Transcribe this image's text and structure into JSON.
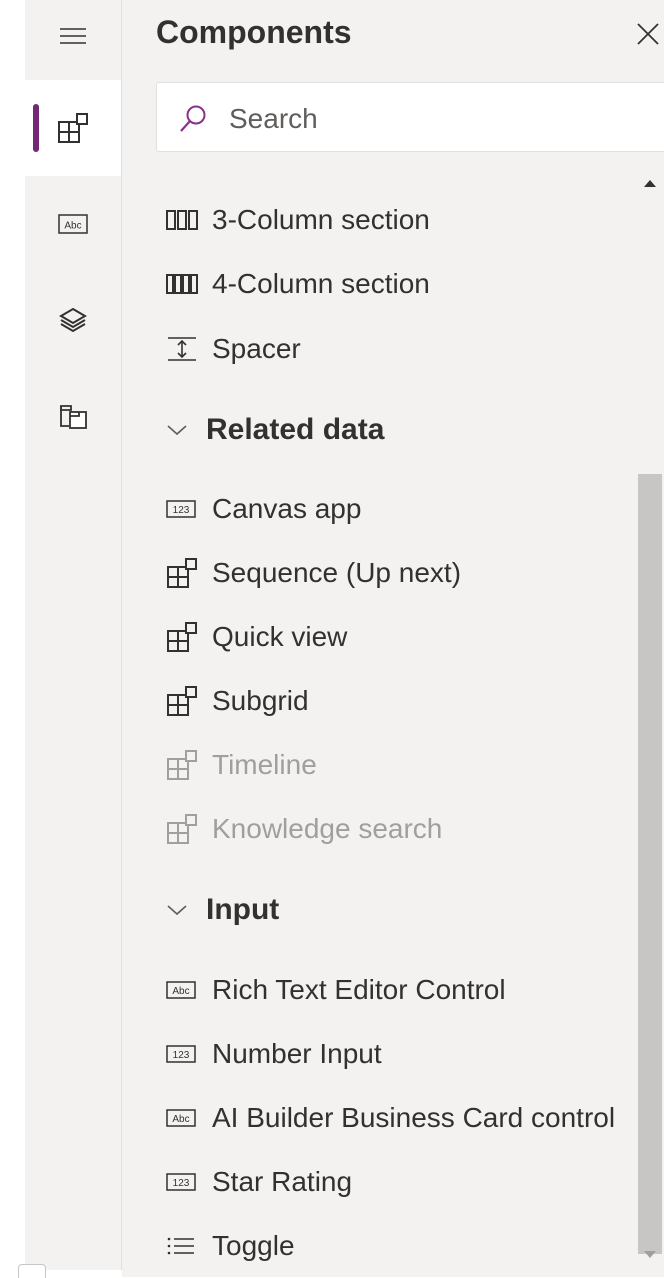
{
  "panel": {
    "title": "Components",
    "search_placeholder": "Search"
  },
  "rail": {
    "items": [
      {
        "name": "components",
        "active": true
      },
      {
        "name": "text-field",
        "active": false
      },
      {
        "name": "layers",
        "active": false
      },
      {
        "name": "copy-form",
        "active": false
      }
    ]
  },
  "layout_items": [
    {
      "label": "3-Column section",
      "icon": "three-column-icon"
    },
    {
      "label": "4-Column section",
      "icon": "four-column-icon"
    },
    {
      "label": "Spacer",
      "icon": "spacer-icon"
    }
  ],
  "related_data": {
    "heading": "Related data",
    "items": [
      {
        "label": "Canvas app",
        "icon": "number-123-icon",
        "enabled": true
      },
      {
        "label": "Sequence (Up next)",
        "icon": "components-icon",
        "enabled": true
      },
      {
        "label": "Quick view",
        "icon": "components-icon",
        "enabled": true
      },
      {
        "label": "Subgrid",
        "icon": "components-icon",
        "enabled": true
      },
      {
        "label": "Timeline",
        "icon": "components-icon",
        "enabled": false
      },
      {
        "label": "Knowledge search",
        "icon": "components-icon",
        "enabled": false
      }
    ]
  },
  "input": {
    "heading": "Input",
    "items": [
      {
        "label": "Rich Text Editor Control",
        "icon": "abc-icon"
      },
      {
        "label": "Number Input",
        "icon": "number-123-icon"
      },
      {
        "label": "AI Builder Business Card control",
        "icon": "abc-icon"
      },
      {
        "label": "Star Rating",
        "icon": "number-123-icon"
      },
      {
        "label": "Toggle",
        "icon": "list-icon"
      }
    ]
  },
  "colors": {
    "accent": "#742774",
    "panel_bg": "#f3f2f1",
    "text": "#323130",
    "disabled_text": "#a19f9d",
    "search_icon": "#8a2f8a"
  }
}
